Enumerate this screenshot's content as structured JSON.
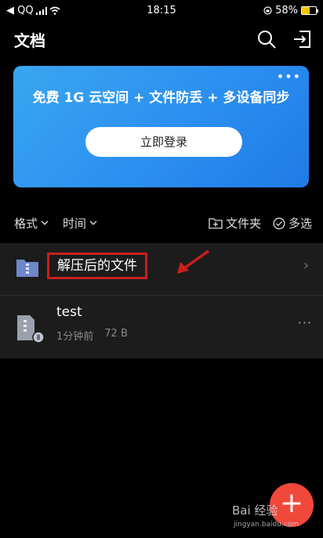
{
  "status": {
    "back_label": "◀ QQ",
    "time": "18:15",
    "battery_text": "58%",
    "battery_level": 0.58
  },
  "nav": {
    "title": "文档",
    "search_icon": "search-icon",
    "export_icon": "sign-in-icon"
  },
  "banner": {
    "more": "•••",
    "text": "免费 1G 云空间 + 文件防丢 + 多设备同步",
    "login_label": "立即登录"
  },
  "toolbar": {
    "format_label": "格式",
    "time_label": "时间",
    "new_folder_label": "文件夹",
    "multi_select_label": "多选"
  },
  "files": [
    {
      "name": "解压后的文件",
      "type": "folder"
    },
    {
      "name": "test",
      "type": "zip",
      "modified": "1分钟前",
      "size": "72 B"
    }
  ],
  "fab": {
    "label": "+"
  },
  "watermark": {
    "text": "Bai 经验",
    "url": "jingyan.baidu.com"
  },
  "colors": {
    "accent_blue": "#2b8ff0",
    "highlight_red": "#c8201f",
    "fab_red": "#f0493c"
  }
}
